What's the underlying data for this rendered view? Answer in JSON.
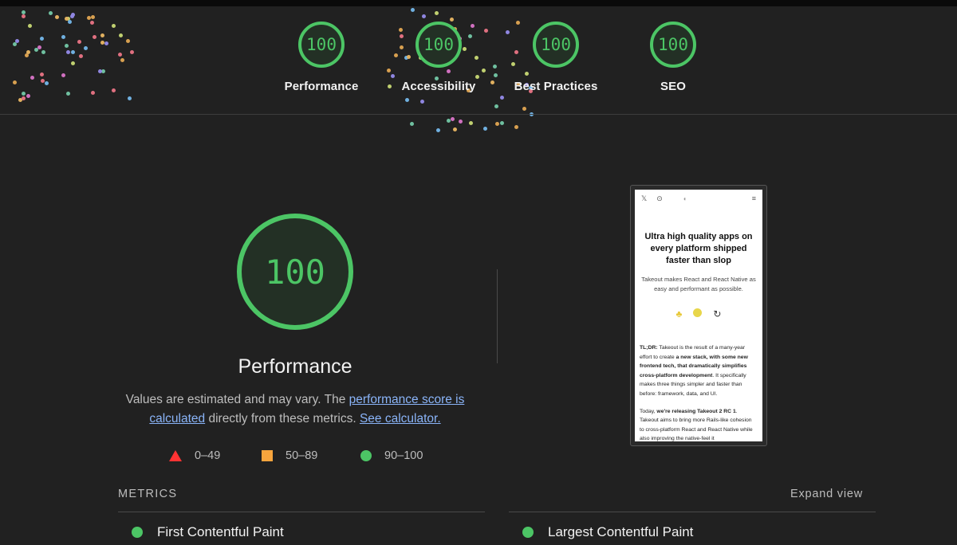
{
  "categories": [
    {
      "score": "100",
      "label": "Performance"
    },
    {
      "score": "100",
      "label": "Accessibility"
    },
    {
      "score": "100",
      "label": "Best Practices"
    },
    {
      "score": "100",
      "label": "SEO"
    }
  ],
  "main": {
    "score": "100",
    "title": "Performance",
    "desc_prefix": "Values are estimated and may vary. The ",
    "link_score": "performance score is calculated",
    "desc_middle": " directly from these metrics. ",
    "link_calc": "See calculator."
  },
  "legend": {
    "fail": "0–49",
    "average": "50–89",
    "pass": "90–100"
  },
  "colors": {
    "pass": "#4cc565",
    "average": "#f8a53d",
    "fail": "#ff3333",
    "link": "#8ab4f8",
    "background": "#212121"
  },
  "screenshot": {
    "nav_x": "𝕏",
    "nav_github": "⊙",
    "nav_logo": "◐",
    "nav_menu": "≡",
    "headline": "Ultra high quality apps on every platform shipped faster than slop",
    "sub": "Takeout makes React and React Native as easy and performant as possible.",
    "p1_tldr": "TL;DR:",
    "p1_a": " Takeout is the result of a many-year effort to create ",
    "p1_bold": "a new stack, with some new frontend tech, that dramatically simplifies cross-platform development",
    "p1_b": ". It specifically makes three things simpler and faster than before: framework, data, and UI.",
    "p2_a": "Today, ",
    "p2_bold": "we're releasing Takeout 2 RC 1",
    "p2_b": ". Takeout aims to bring more Rails-like cohesion to cross-platform React and React Native while also improving the native-feel it"
  },
  "metrics": {
    "label": "METRICS",
    "expand": "Expand view",
    "items": [
      "First Contentful Paint",
      "Largest Contentful Paint"
    ]
  }
}
